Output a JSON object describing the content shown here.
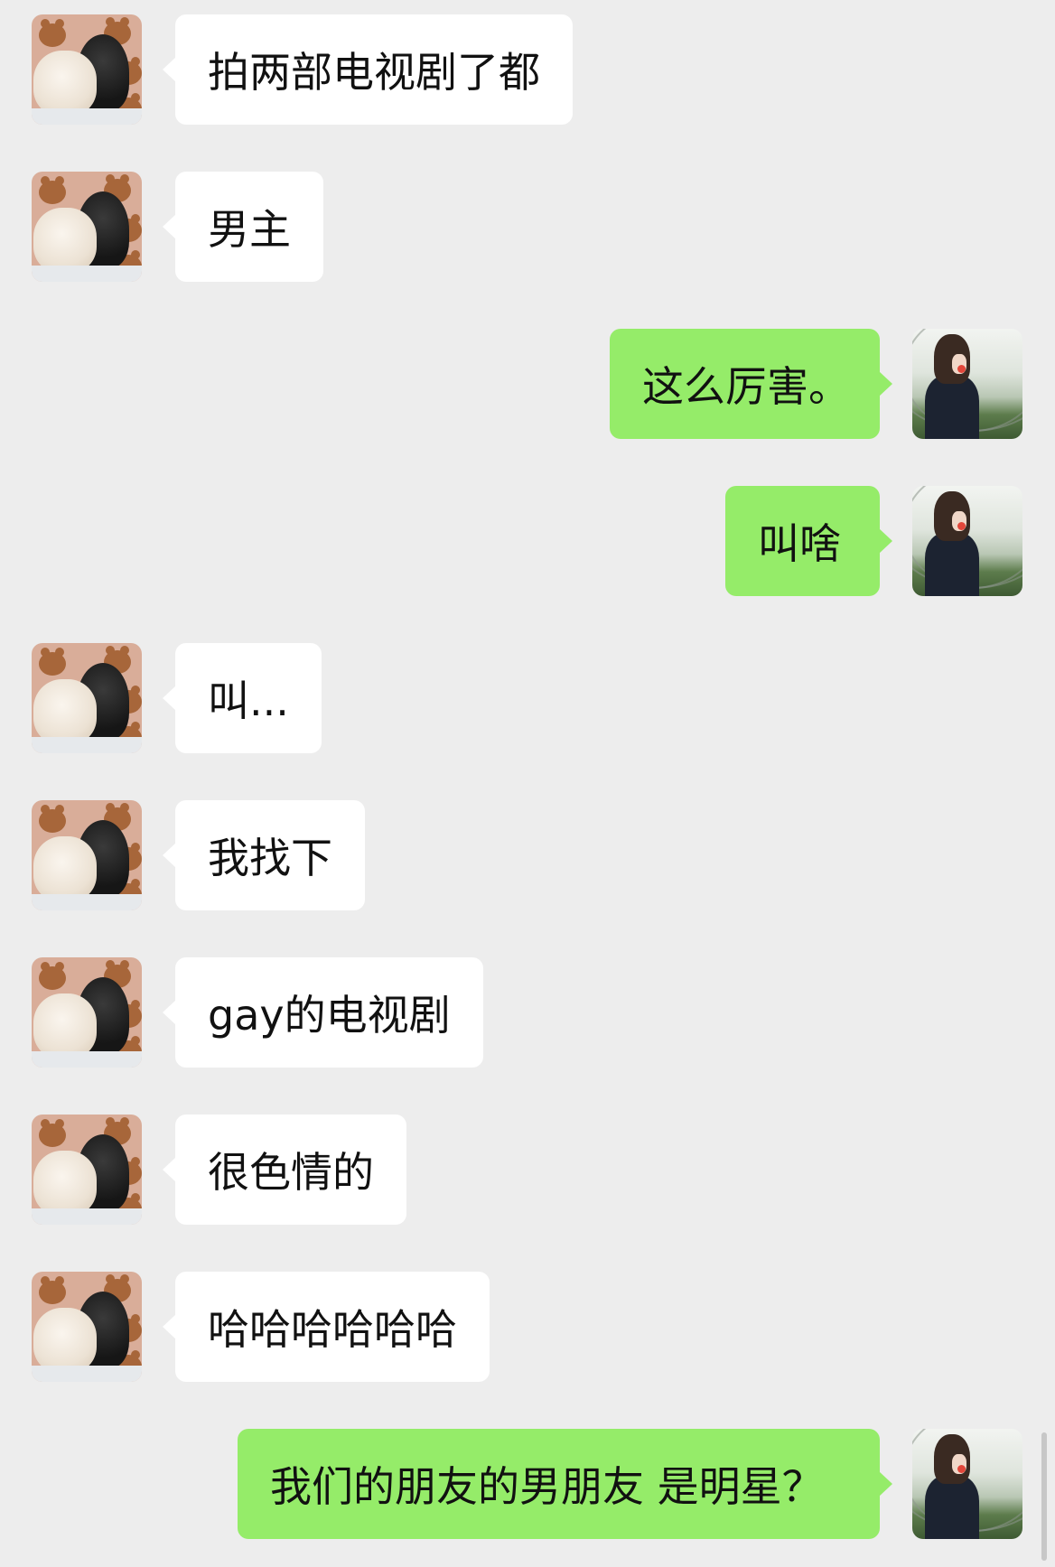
{
  "conversation": {
    "messages": [
      {
        "side": "left",
        "text": "拍两部电视剧了都"
      },
      {
        "side": "left",
        "text": "男主"
      },
      {
        "side": "right",
        "text": "这么厉害。"
      },
      {
        "side": "right",
        "text": "叫啥"
      },
      {
        "side": "left",
        "text": "叫..."
      },
      {
        "side": "left",
        "text": "我找下"
      },
      {
        "side": "left",
        "text": "gay的电视剧"
      },
      {
        "side": "left",
        "text": "很色情的"
      },
      {
        "side": "left",
        "text": "哈哈哈哈哈哈"
      },
      {
        "side": "right",
        "text": "我们的朋友的男朋友 是明星？"
      }
    ]
  },
  "colors": {
    "background": "#ededed",
    "incoming_bubble": "#ffffff",
    "outgoing_bubble": "#95ec69"
  }
}
